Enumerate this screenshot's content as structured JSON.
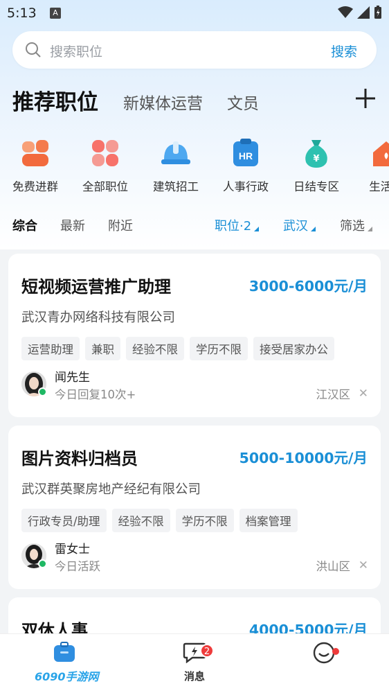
{
  "status_bar": {
    "time": "5:13",
    "notif_badge": "A"
  },
  "search": {
    "placeholder": "搜索职位",
    "button": "搜索"
  },
  "job_tabs": {
    "active": "推荐职位",
    "items": [
      "新媒体运营",
      "文员"
    ]
  },
  "categories": [
    {
      "label": "免费进群",
      "icon": "group-icon"
    },
    {
      "label": "全部职位",
      "icon": "grid-icon"
    },
    {
      "label": "建筑招工",
      "icon": "helmet-icon"
    },
    {
      "label": "人事行政",
      "icon": "hr-icon"
    },
    {
      "label": "日结专区",
      "icon": "money-bag-icon"
    },
    {
      "label": "生活服",
      "icon": "home-icon"
    }
  ],
  "filters": {
    "sort": [
      "综合",
      "最新",
      "附近"
    ],
    "position": "职位·2",
    "city": "武汉",
    "more": "筛选"
  },
  "jobs": [
    {
      "title": "短视频运营推广助理",
      "salary": "3000-6000元/月",
      "company": "武汉青办网络科技有限公司",
      "tags": [
        "运营助理",
        "兼职",
        "经验不限",
        "学历不限",
        "接受居家办公"
      ],
      "hr_name": "闻先生",
      "hr_status": "今日回复10次+",
      "district": "江汉区"
    },
    {
      "title": "图片资料归档员",
      "salary": "5000-10000元/月",
      "company": "武汉群英聚房地产经纪有限公司",
      "tags": [
        "行政专员/助理",
        "经验不限",
        "学历不限",
        "档案管理"
      ],
      "hr_name": "雷女士",
      "hr_status": "今日活跃",
      "district": "洪山区"
    },
    {
      "title": "双休人事",
      "salary": "4000-5000元/月"
    }
  ],
  "bottom_nav": {
    "messages_label": "消息",
    "messages_badge": "2",
    "watermark": "6090手游网"
  },
  "colors": {
    "accent": "#1a8fd6",
    "online": "#1fb864",
    "badge": "#ee3b3b"
  }
}
